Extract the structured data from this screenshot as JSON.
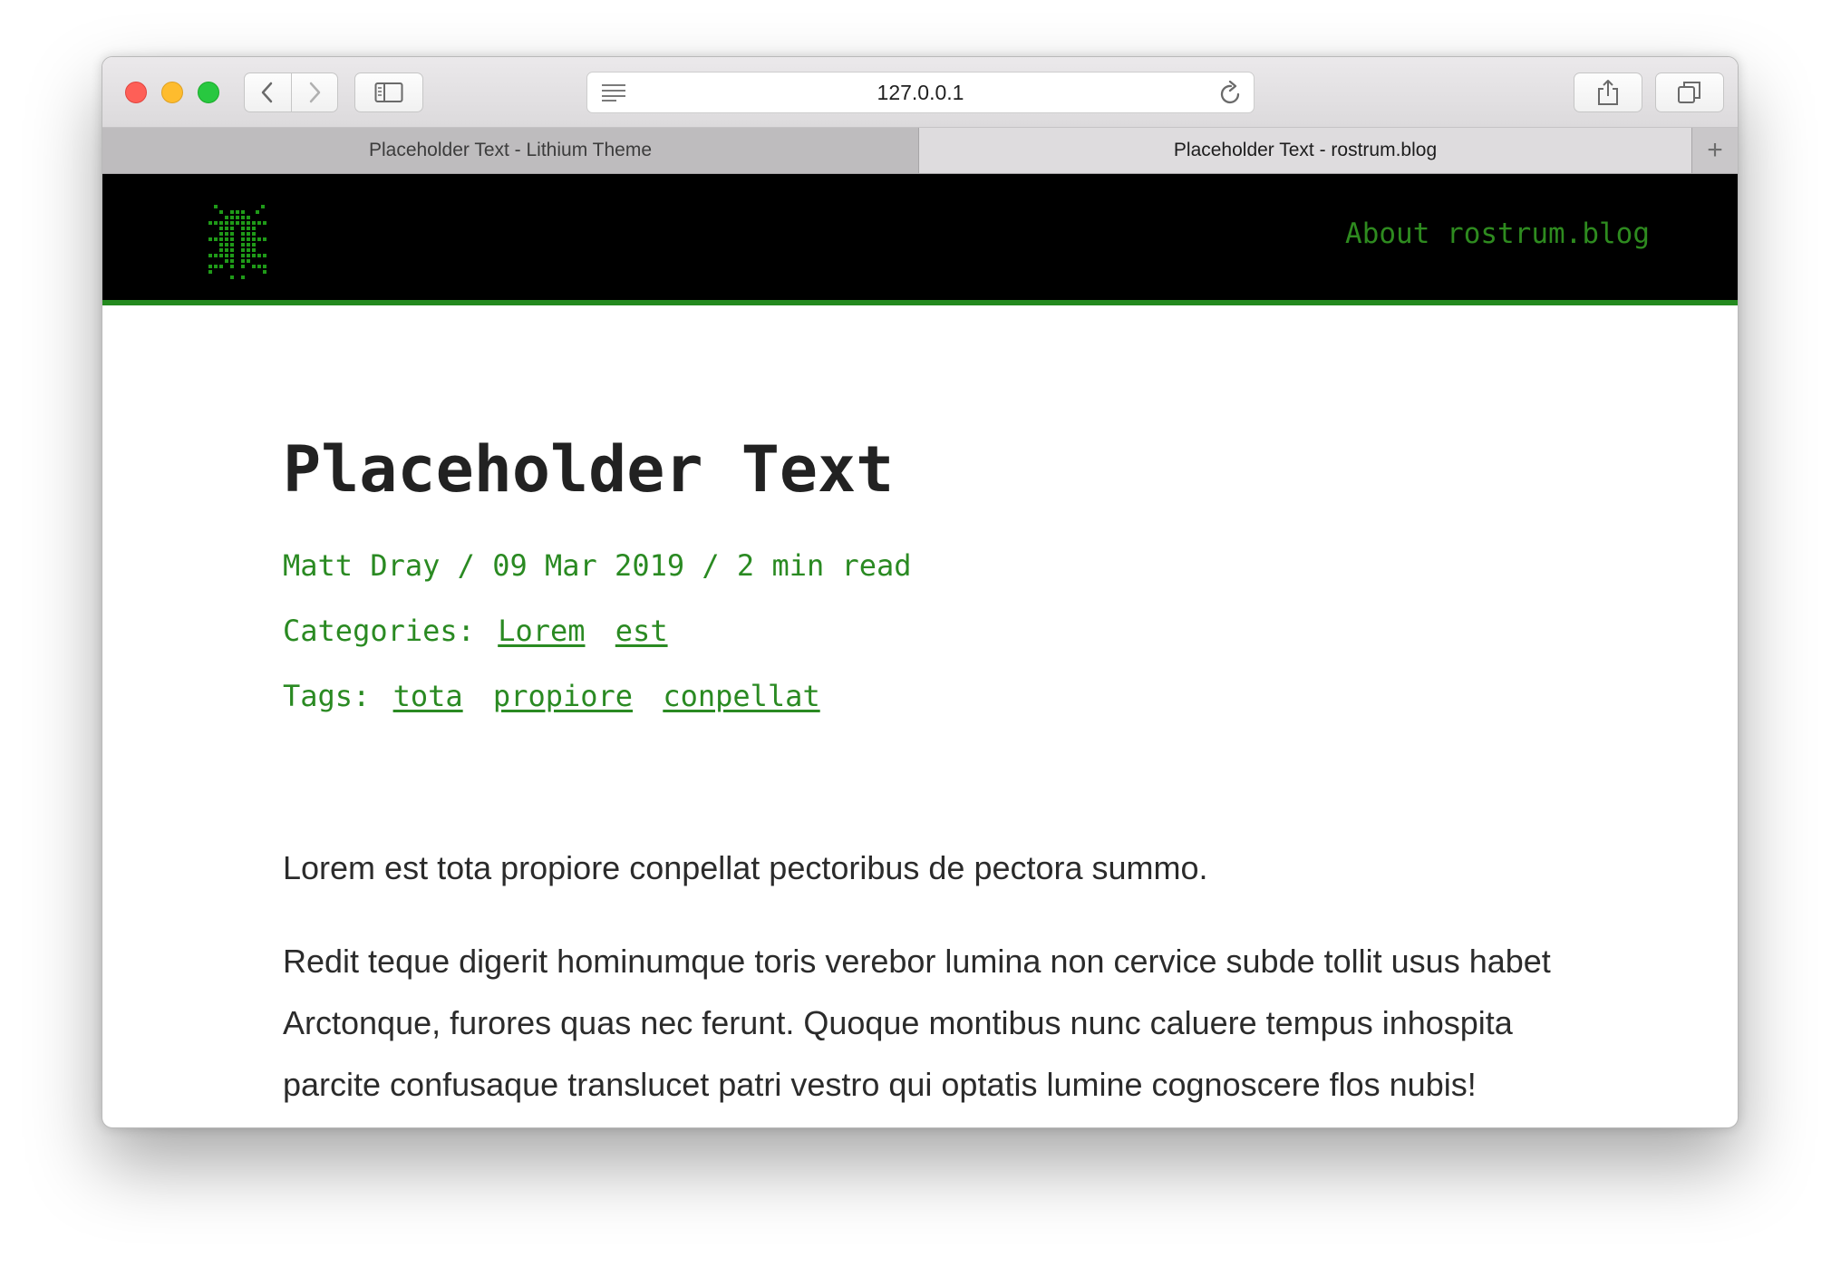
{
  "browser": {
    "url": "127.0.0.1",
    "tabs": [
      {
        "title": "Placeholder Text - Lithium Theme",
        "active": false
      },
      {
        "title": "Placeholder Text - rostrum.blog",
        "active": true
      }
    ],
    "new_tab_label": "+",
    "icons": [
      "back-icon",
      "forward-icon",
      "sidebar-icon",
      "reader-icon",
      "reload-icon",
      "share-icon",
      "tabs-overview-icon"
    ]
  },
  "site": {
    "logo_icon": "bug-icon",
    "nav_link": "About rostrum.blog",
    "accent_color": "#2a8a22"
  },
  "post": {
    "title": "Placeholder Text",
    "meta": "Matt Dray / 09 Mar 2019 / 2 min read",
    "categories_label": "Categories:",
    "categories": [
      "Lorem",
      "est"
    ],
    "tags_label": "Tags:",
    "tags": [
      "tota",
      "propiore",
      "conpellat"
    ],
    "paragraphs": [
      "Lorem est tota propiore conpellat pectoribus de pectora summo.",
      "Redit teque digerit hominumque toris verebor lumina non cervice subde tollit usus habet Arctonque, furores quas nec ferunt. Quoque montibus nunc caluere tempus inhospita parcite confusaque translucet patri vestro qui optatis lumine cognoscere flos nubis! Fronde ipsamque patulos Dryopen deorum."
    ]
  }
}
